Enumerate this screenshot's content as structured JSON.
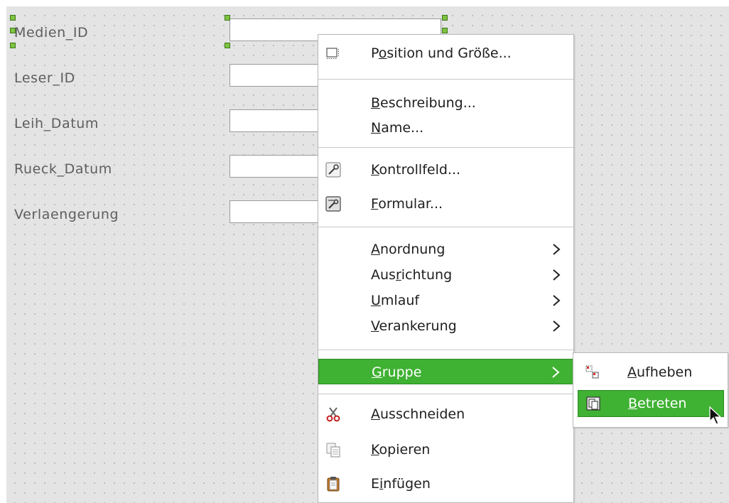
{
  "form": {
    "labels": [
      "Medien_ID",
      "Leser_ID",
      "Leih_Datum",
      "Rueck_Datum",
      "Verlaengerung"
    ]
  },
  "context_menu": {
    "items": [
      {
        "pre": "P",
        "acc": "o",
        "post": "sition und Größe...",
        "icon": "position-size-icon"
      },
      {
        "pre": "",
        "acc": "B",
        "post": "eschreibung...",
        "icon": ""
      },
      {
        "pre": "",
        "acc": "N",
        "post": "ame...",
        "icon": ""
      },
      {
        "pre": "",
        "acc": "K",
        "post": "ontrollfeld...",
        "icon": "control-properties-icon"
      },
      {
        "pre": "",
        "acc": "F",
        "post": "ormular...",
        "icon": "form-properties-icon"
      },
      {
        "pre": "",
        "acc": "A",
        "post": "nordnung",
        "icon": "",
        "submenu": true
      },
      {
        "pre": "Aus",
        "acc": "r",
        "post": "ichtung",
        "icon": "",
        "submenu": true
      },
      {
        "pre": "",
        "acc": "U",
        "post": "mlauf",
        "icon": "",
        "submenu": true
      },
      {
        "pre": "",
        "acc": "V",
        "post": "erankerung",
        "icon": "",
        "submenu": true
      },
      {
        "pre": "",
        "acc": "G",
        "post": "ruppe",
        "icon": "",
        "submenu": true,
        "highlighted": true
      },
      {
        "pre": "",
        "acc": "A",
        "post": "usschneiden",
        "icon": "cut-icon"
      },
      {
        "pre": "",
        "acc": "K",
        "post": "opieren",
        "icon": "copy-icon"
      },
      {
        "pre": "E",
        "acc": "i",
        "post": "nfügen",
        "icon": "paste-icon"
      }
    ]
  },
  "group_submenu": {
    "items": [
      {
        "pre": "",
        "acc": "A",
        "post": "ufheben",
        "icon": "ungroup-icon"
      },
      {
        "pre": "",
        "acc": "B",
        "post": "etreten",
        "icon": "enter-group-icon",
        "highlighted": true
      }
    ]
  },
  "colors": {
    "highlight": "#3fb133",
    "handle": "#7fc241",
    "canvas": "#e4e4e4"
  }
}
